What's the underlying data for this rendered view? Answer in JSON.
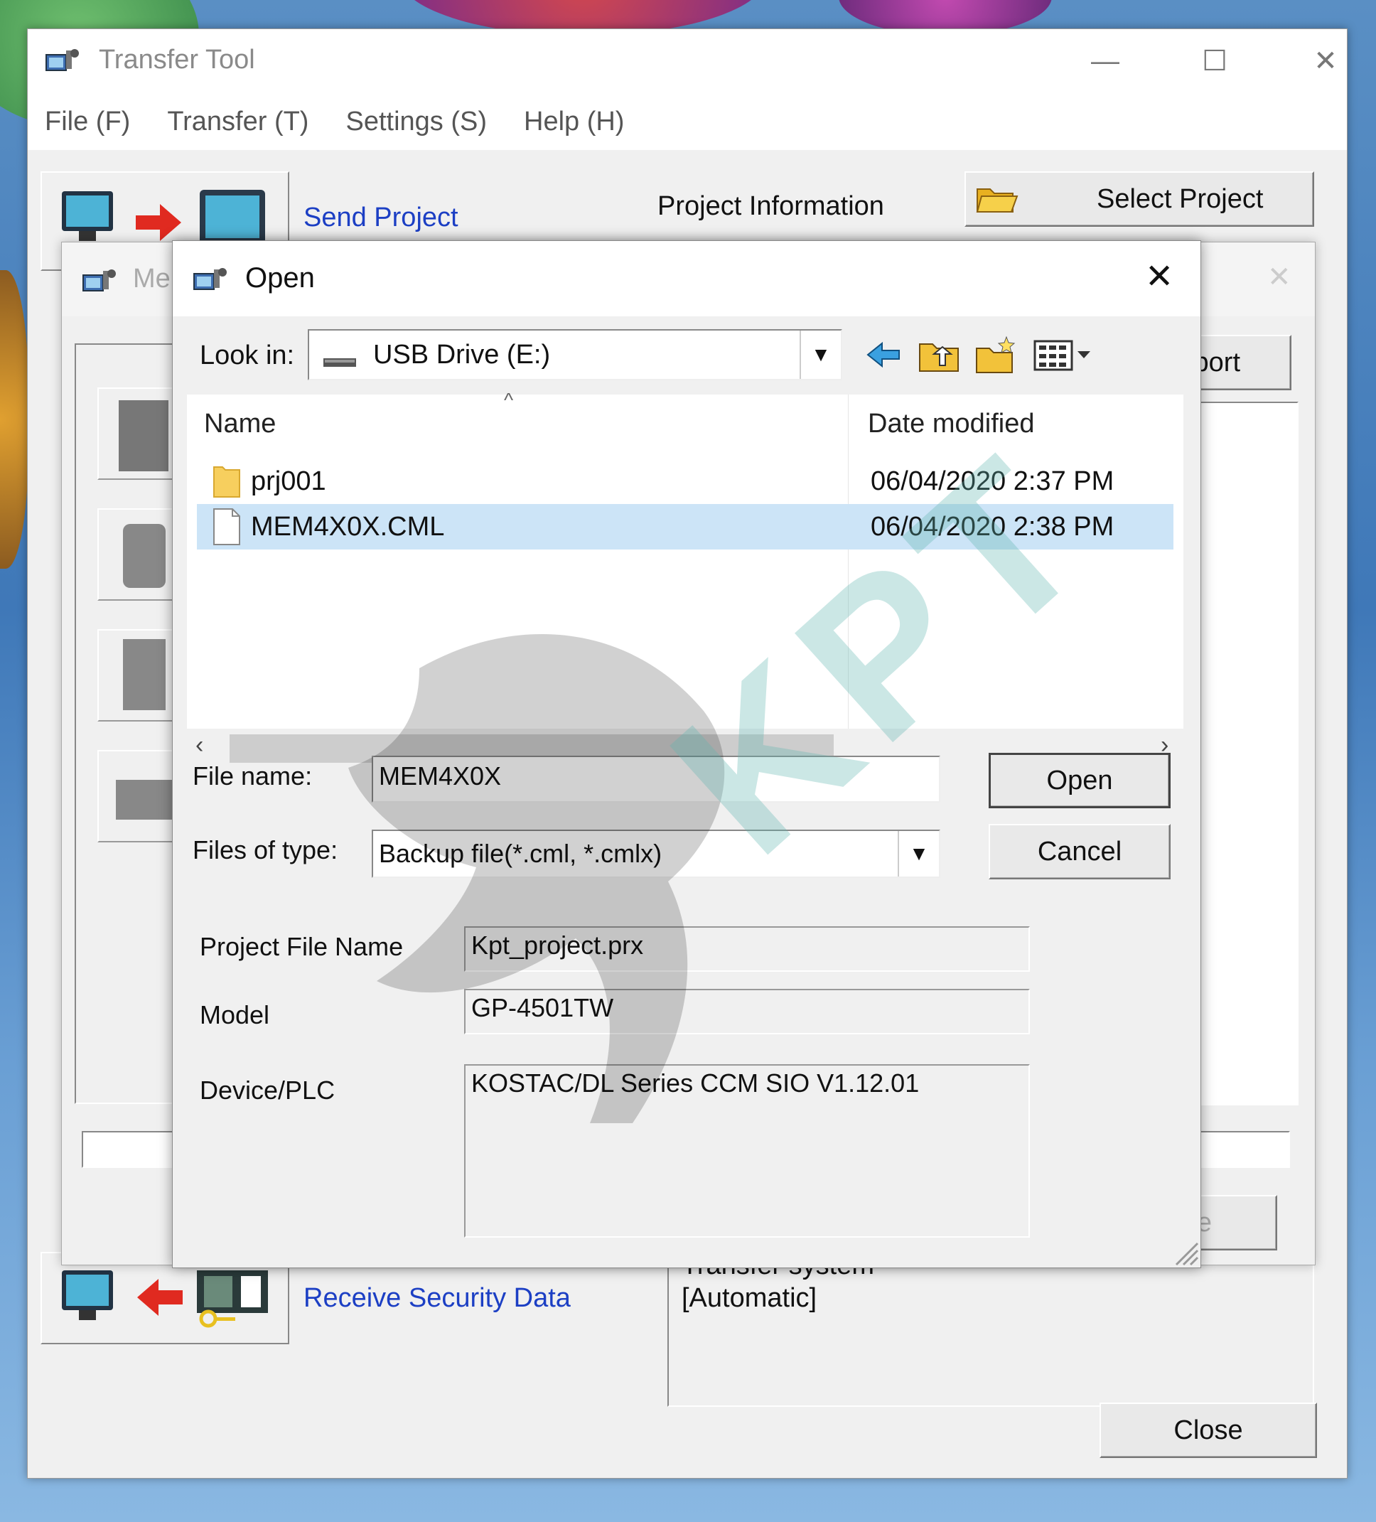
{
  "main_window": {
    "title": "Transfer Tool",
    "menu": [
      "File (F)",
      "Transfer (T)",
      "Settings (S)",
      "Help (H)"
    ],
    "send_project_label": "Send Project",
    "project_info_label": "Project Information",
    "select_project_label": "Select Project",
    "receive_security_label": "Receive Security Data",
    "transfer_system_text": "Transfer system",
    "transfer_mode_text": "[Automatic]",
    "close_label": "Close"
  },
  "mid_dialog": {
    "title_partial": "Me",
    "import_button_partial": "port",
    "bottom_button_partial": "e"
  },
  "open_dialog": {
    "title": "Open",
    "look_in_label": "Look in:",
    "look_in_value": "USB Drive (E:)",
    "columns": {
      "name": "Name",
      "date": "Date modified"
    },
    "files": [
      {
        "name": "prj001",
        "date": "06/04/2020 2:37 PM",
        "type": "folder",
        "selected": false
      },
      {
        "name": "MEM4X0X.CML",
        "date": "06/04/2020 2:38 PM",
        "type": "file",
        "selected": true
      }
    ],
    "file_name_label": "File name:",
    "file_name_value": "MEM4X0X",
    "files_of_type_label": "Files of type:",
    "files_of_type_value": "Backup file(*.cml, *.cmlx)",
    "open_button": "Open",
    "cancel_button": "Cancel",
    "project_file_name_label": "Project File Name",
    "project_file_name_value": "Kpt_project.prx",
    "model_label": "Model",
    "model_value": "GP-4501TW",
    "device_label": "Device/PLC",
    "device_value": "KOSTAC/DL Series CCM SIO V1.12.01"
  },
  "watermark": {
    "text": "KPT"
  },
  "colors": {
    "link": "#1c3fc4",
    "selection": "#cce4f7",
    "folder": "#f5c84c",
    "watermark": "#5fb5b0"
  },
  "icons": [
    "transfer-tool-icon",
    "pc-icon",
    "red-arrow-icon",
    "display-icon",
    "folder-open-icon",
    "usb-drive-icon",
    "back-arrow-icon",
    "up-folder-icon",
    "new-folder-icon",
    "view-menu-icon",
    "folder-icon",
    "file-icon"
  ]
}
